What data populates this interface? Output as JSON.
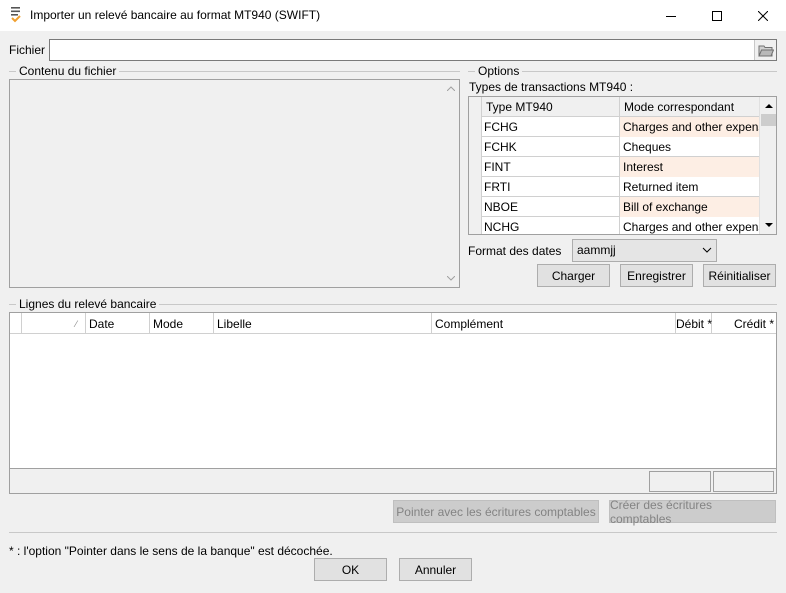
{
  "window": {
    "title": "Importer un relevé bancaire au format MT940 (SWIFT)",
    "controls": {
      "minimize": "—",
      "maximize": "☐",
      "close": "✕"
    }
  },
  "fichier": {
    "label": "Fichier",
    "value": ""
  },
  "contenu": {
    "title": "Contenu du fichier"
  },
  "options": {
    "title": "Options",
    "types_label": "Types de transactions MT940 :",
    "grid": {
      "headers": [
        "Type MT940",
        "Mode correspondant"
      ],
      "rows": [
        {
          "type": "FCHG",
          "mode": "Charges and other expenses"
        },
        {
          "type": "FCHK",
          "mode": "Cheques"
        },
        {
          "type": "FINT",
          "mode": "Interest"
        },
        {
          "type": "FRTI",
          "mode": "Returned item"
        },
        {
          "type": "NBOE",
          "mode": "Bill of exchange"
        },
        {
          "type": "NCHG",
          "mode": "Charges and other expenses"
        }
      ]
    },
    "format_label": "Format des dates",
    "format_value": "aammjj",
    "buttons": {
      "charger": "Charger",
      "enregistrer": "Enregistrer",
      "reinitialiser": "Réinitialiser"
    }
  },
  "lignes": {
    "title": "Lignes du relevé bancaire",
    "columns": [
      "",
      "Date",
      "Mode",
      "Libelle",
      "Complément",
      "Débit *",
      "Crédit *"
    ]
  },
  "actions": {
    "pointer": "Pointer avec les écritures comptables",
    "creer": "Créer des écritures comptables"
  },
  "note": "* : l'option \"Pointer dans le sens de la banque\" est décochée.",
  "footer": {
    "ok": "OK",
    "annuler": "Annuler"
  }
}
